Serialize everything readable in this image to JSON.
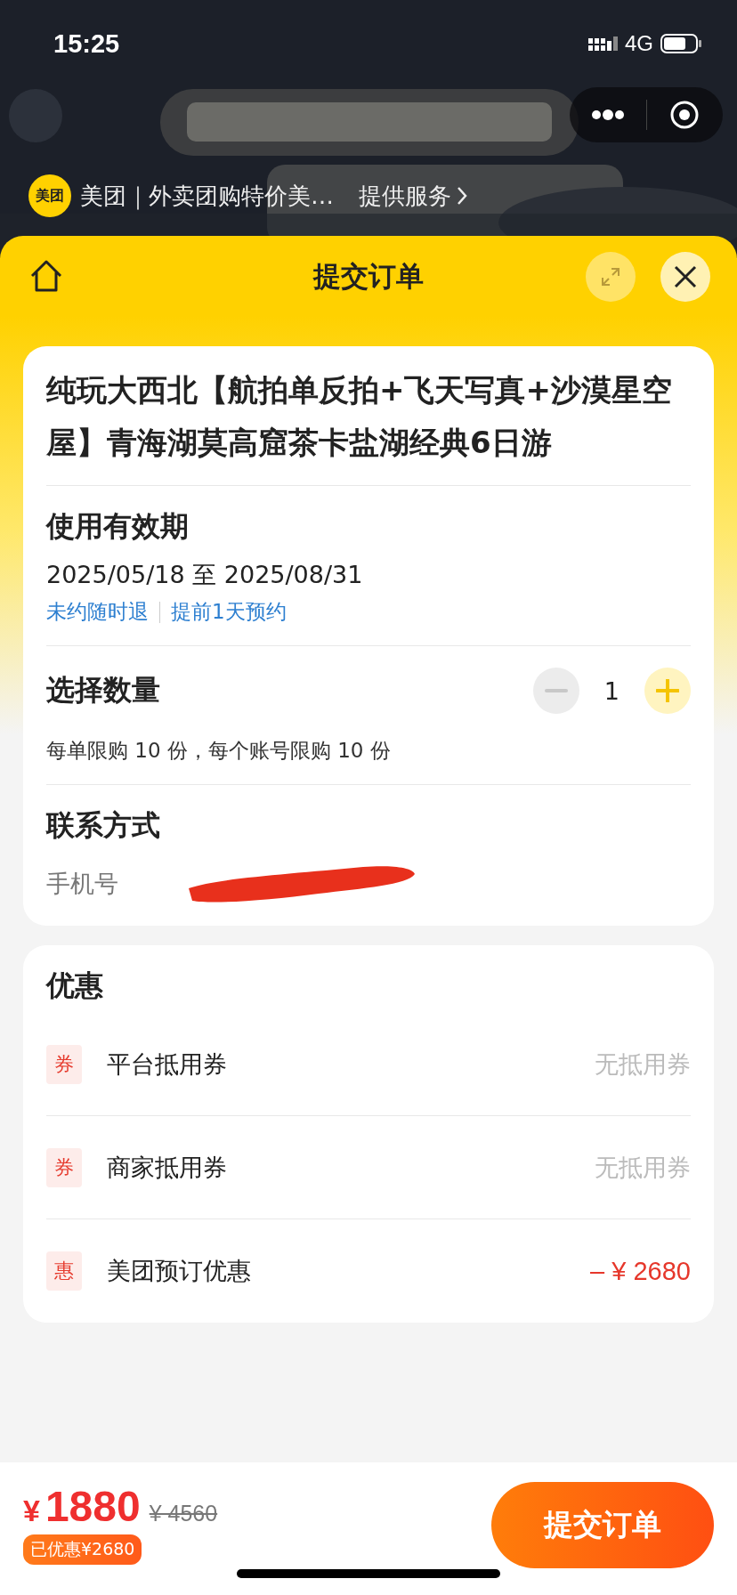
{
  "status_bar": {
    "time": "15:25",
    "network": "4G"
  },
  "mini_program": {
    "logo_text": "美团",
    "service_name": "美团｜外卖团购特价美…",
    "provider": "提供服务"
  },
  "header": {
    "title": "提交订单"
  },
  "product": {
    "title": "纯玩大西北【航拍单反拍+飞天写真+沙漠星空屋】青海湖莫高窟茶卡盐湖经典6日游",
    "validity_label": "使用有效期",
    "validity": "2025/05/18 至 2025/08/31",
    "tags": [
      "未约随时退",
      "提前1天预约"
    ]
  },
  "quantity": {
    "label": "选择数量",
    "value": "1",
    "minus_disabled": true,
    "limit_note": "每单限购 10 份，每个账号限购 10 份"
  },
  "contact": {
    "label": "联系方式",
    "phone_label": "手机号"
  },
  "discounts": {
    "title": "优惠",
    "items": [
      {
        "kind": "coupon",
        "badge": "券",
        "name": "平台抵用券",
        "value": "无抵用券"
      },
      {
        "kind": "coupon",
        "badge": "券",
        "name": "商家抵用券",
        "value": "无抵用券"
      },
      {
        "kind": "deal",
        "badge": "惠",
        "name": "美团预订优惠",
        "value": "– ¥ 2680"
      }
    ]
  },
  "footer": {
    "currency": "¥",
    "amount": "1880",
    "original_price": "¥ 4560",
    "saved": "已优惠¥2680",
    "submit": "提交订单"
  }
}
